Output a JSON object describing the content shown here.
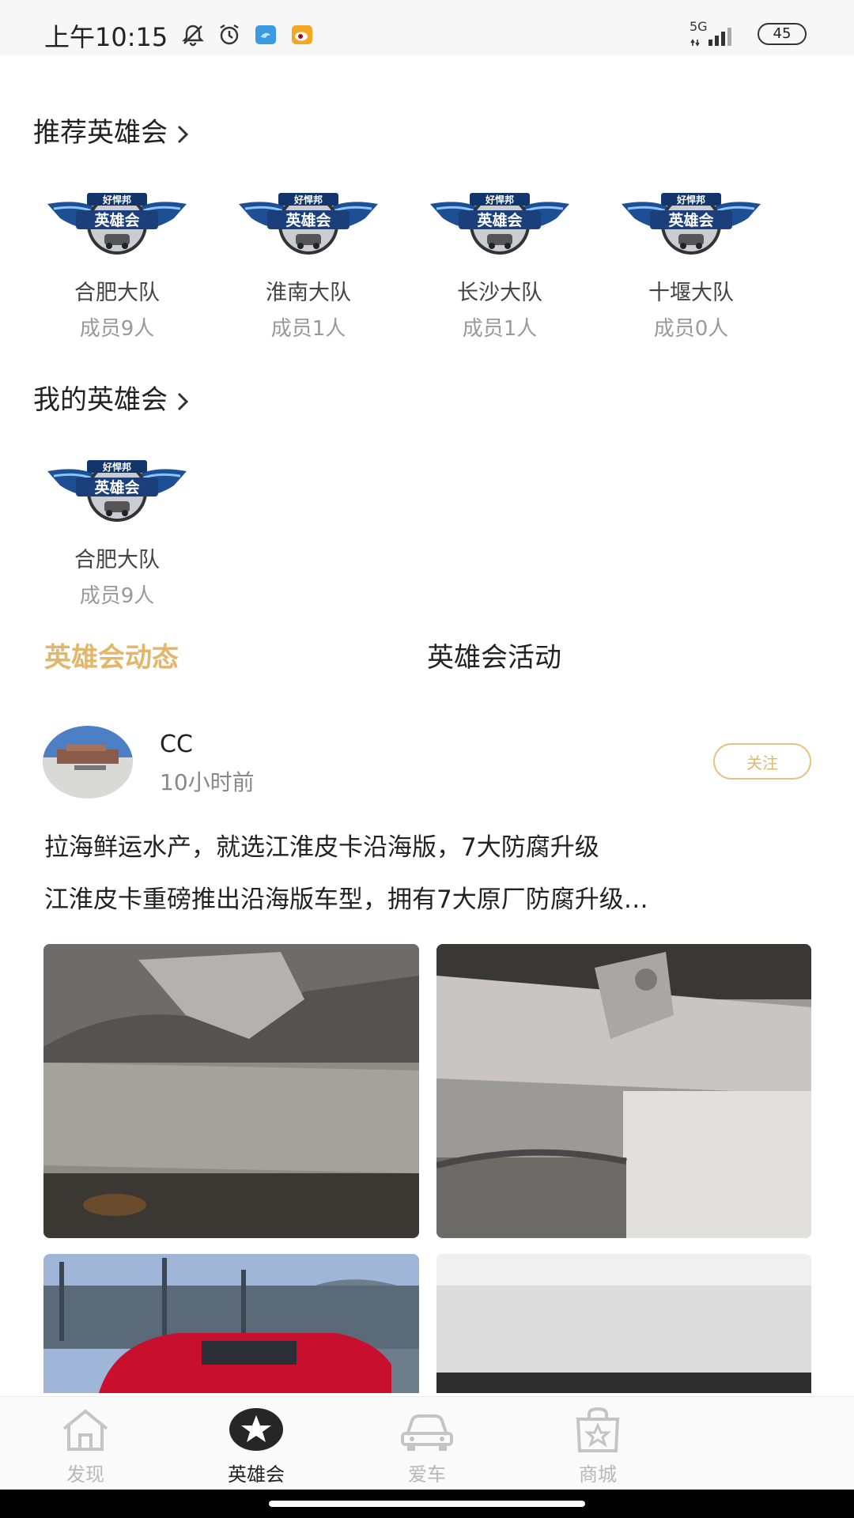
{
  "status_bar": {
    "time": "上午10:15",
    "network": "5G",
    "battery": "45",
    "icons": [
      "bell-off-icon",
      "alarm-icon",
      "app-badge-blue-icon",
      "weibo-icon",
      "signal-icon"
    ]
  },
  "recommended": {
    "title": "推荐英雄会",
    "clubs": [
      {
        "name": "合肥大队",
        "members": "成员9人",
        "logo_text_top": "好悍邦",
        "logo_text_main": "英雄会"
      },
      {
        "name": "淮南大队",
        "members": "成员1人",
        "logo_text_top": "好悍邦",
        "logo_text_main": "英雄会"
      },
      {
        "name": "长沙大队",
        "members": "成员1人",
        "logo_text_top": "好悍邦",
        "logo_text_main": "英雄会"
      },
      {
        "name": "十堰大队",
        "members": "成员0人",
        "logo_text_top": "好悍邦",
        "logo_text_main": "英雄会"
      }
    ]
  },
  "mine": {
    "title": "我的英雄会",
    "clubs": [
      {
        "name": "合肥大队",
        "members": "成员9人",
        "logo_text_top": "好悍邦",
        "logo_text_main": "英雄会"
      }
    ]
  },
  "tabs": {
    "active": "英雄会动态",
    "inactive": "英雄会活动"
  },
  "post": {
    "username": "CC",
    "time": "10小时前",
    "follow_label": "关注",
    "title": "拉海鲜运水产，就选江淮皮卡沿海版，7大防腐升级",
    "excerpt": "江淮皮卡重磅推出沿海版车型，拥有7大原厂防腐升级…"
  },
  "bottom_nav": {
    "items": [
      {
        "label": "发现",
        "icon": "home-icon",
        "active": false
      },
      {
        "label": "英雄会",
        "icon": "star-icon",
        "active": true
      },
      {
        "label": "爱车",
        "icon": "car-icon",
        "active": false
      },
      {
        "label": "商城",
        "icon": "shopping-bag-icon",
        "active": false
      }
    ]
  },
  "colors": {
    "accent": "#e4b66a",
    "text_primary": "#222222",
    "text_secondary": "#999999"
  }
}
